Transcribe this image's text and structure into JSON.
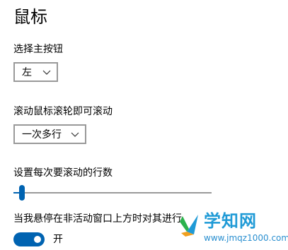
{
  "page": {
    "title": "鼠标"
  },
  "primary_button": {
    "label": "选择主按钮",
    "selected": "左"
  },
  "scroll_mode": {
    "label": "滚动鼠标滚轮即可滚动",
    "selected": "一次多行"
  },
  "scroll_lines": {
    "label": "设置每次要滚动的行数",
    "value_fraction": 0.03
  },
  "inactive_scroll": {
    "label": "当我悬停在非活动窗口上方时对其进行",
    "toggle_state": "on",
    "toggle_label": "开"
  },
  "watermark": {
    "name": "学知网",
    "url": "www.jmqz1000.com"
  },
  "colors": {
    "accent": "#0063b1",
    "watermark": "#1f9ad6"
  }
}
